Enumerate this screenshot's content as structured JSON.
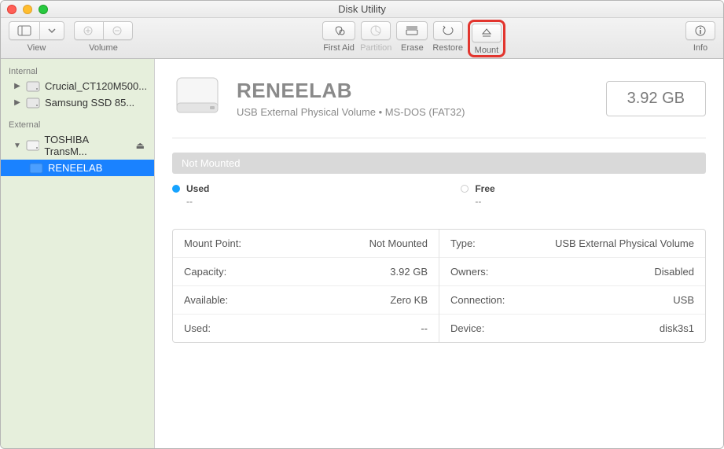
{
  "window": {
    "title": "Disk Utility"
  },
  "toolbar": {
    "view_label": "View",
    "volume_label": "Volume",
    "first_aid": "First Aid",
    "partition": "Partition",
    "erase": "Erase",
    "restore": "Restore",
    "mount": "Mount",
    "info": "Info"
  },
  "sidebar": {
    "internal_label": "Internal",
    "external_label": "External",
    "internal": [
      {
        "label": "Crucial_CT120M500..."
      },
      {
        "label": "Samsung SSD 85..."
      }
    ],
    "external": [
      {
        "label": "TOSHIBA TransM...",
        "children": [
          {
            "label": "RENEELAB",
            "selected": true
          }
        ]
      }
    ]
  },
  "volume": {
    "name": "RENEELAB",
    "subtitle": "USB External Physical Volume • MS-DOS (FAT32)",
    "capacity_badge": "3.92 GB",
    "status": "Not Mounted",
    "legend": {
      "used_label": "Used",
      "used_value": "--",
      "free_label": "Free",
      "free_value": "--"
    },
    "info_left": [
      {
        "k": "Mount Point:",
        "v": "Not Mounted"
      },
      {
        "k": "Capacity:",
        "v": "3.92 GB"
      },
      {
        "k": "Available:",
        "v": "Zero KB"
      },
      {
        "k": "Used:",
        "v": "--"
      }
    ],
    "info_right": [
      {
        "k": "Type:",
        "v": "USB External Physical Volume"
      },
      {
        "k": "Owners:",
        "v": "Disabled"
      },
      {
        "k": "Connection:",
        "v": "USB"
      },
      {
        "k": "Device:",
        "v": "disk3s1"
      }
    ]
  }
}
